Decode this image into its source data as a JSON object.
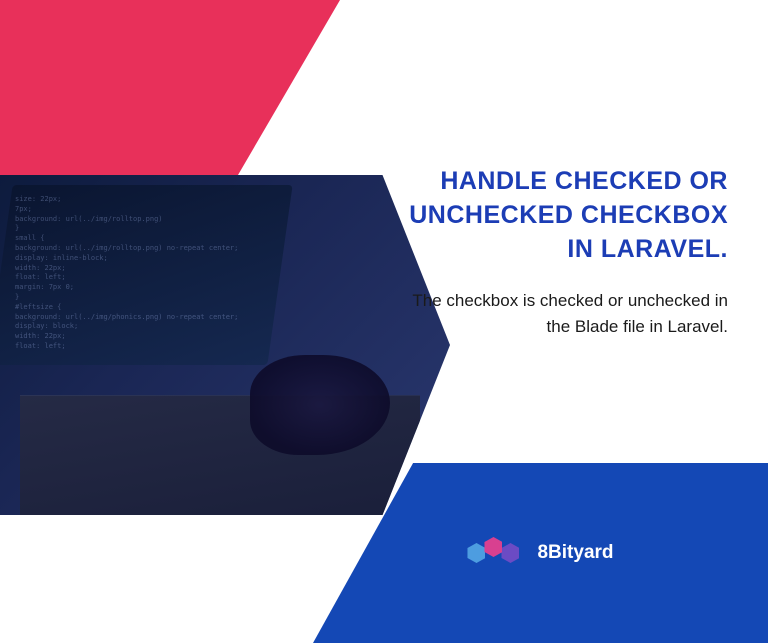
{
  "heading": "HANDLE CHECKED OR UNCHECKED CHECKBOX IN LARAVEL.",
  "subtext": "The checkbox is checked or unchecked in the Blade file in Laravel.",
  "brand": "8Bityard",
  "colors": {
    "pink": "#e8305a",
    "blue_footer": "#1448b5",
    "heading_blue": "#1c3db5"
  }
}
